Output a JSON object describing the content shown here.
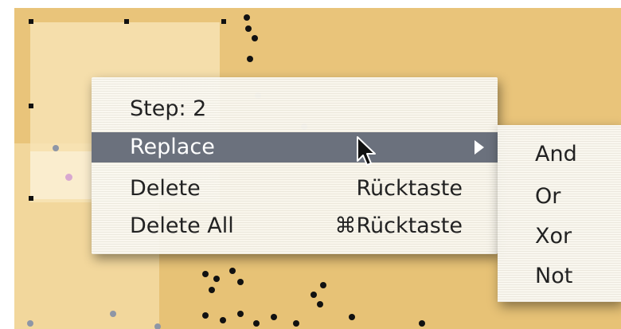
{
  "context_menu": {
    "items": [
      {
        "label": "Step: 2",
        "shortcut": ""
      },
      {
        "label": "Replace",
        "shortcut": ""
      },
      {
        "label": "Delete",
        "shortcut": "Rücktaste"
      },
      {
        "label": "Delete All",
        "shortcut": "⌘Rücktaste"
      }
    ],
    "highlighted_item": "Replace"
  },
  "submenu": {
    "items": [
      "And",
      "Or",
      "Xor",
      "Not"
    ]
  },
  "icons": {
    "submenu_arrow": "triangle-right-icon",
    "cursor": "arrow-pointer-icon"
  },
  "colors": {
    "canvas_background": "#e7c276",
    "menu_highlight": "#6b717d"
  }
}
